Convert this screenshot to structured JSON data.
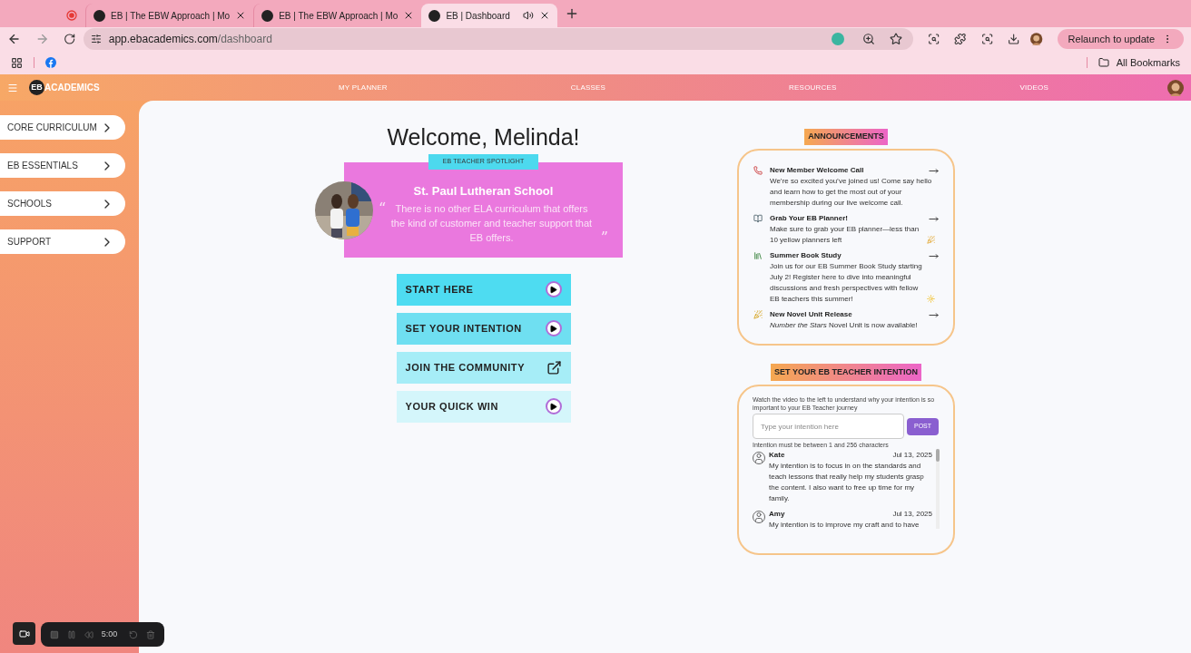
{
  "browser": {
    "tabs": [
      {
        "kind": "recording",
        "selected": false
      },
      {
        "kind": "page",
        "title": "EB | The EBW Approach | Mo",
        "selected": false,
        "audio": false
      },
      {
        "kind": "page",
        "title": "EB | The EBW Approach | Mo",
        "selected": false,
        "audio": false
      },
      {
        "kind": "page",
        "title": "EB | Dashboard",
        "selected": true,
        "audio": true
      }
    ],
    "url_host": "app.ebacademics.com",
    "url_path": "/dashboard",
    "relaunch": "Relaunch to update",
    "bookmarks_folder": "All Bookmarks"
  },
  "site_nav": {
    "logo_mark": "EB",
    "logo_text": "ACADEMICS",
    "links": [
      "MY PLANNER",
      "CLASSES",
      "RESOURCES",
      "VIDEOS"
    ]
  },
  "sidebar": {
    "items": [
      "CORE CURRICULUM",
      "EB ESSENTIALS",
      "SCHOOLS",
      "SUPPORT"
    ]
  },
  "welcome": "Welcome, Melinda!",
  "spotlight": {
    "label": "EB TEACHER SPOTLIGHT",
    "school": "St. Paul Lutheran School",
    "open_quote": "“",
    "close_quote": "”",
    "quote": "There is no other ELA curriculum that offers the kind of customer and teacher support that EB offers."
  },
  "actions": [
    {
      "label": "START HERE",
      "kind": "video"
    },
    {
      "label": "SET YOUR INTENTION",
      "kind": "video"
    },
    {
      "label": "JOIN THE COMMUNITY",
      "kind": "external"
    },
    {
      "label": "YOUR QUICK WIN",
      "kind": "video"
    }
  ],
  "announcements": {
    "title": "ANNOUNCEMENTS",
    "items": [
      {
        "kind": "phone",
        "title": "New Member Welcome Call",
        "body": "We’re so excited you’ve joined us! Come say hello and learn how to get the most out of your membership during our live welcome call."
      },
      {
        "kind": "planner",
        "title": "Grab Your EB Planner!",
        "body": "Make sure to grab your EB planner—less than 10 yellow planners left"
      },
      {
        "kind": "books",
        "title": "Summer Book Study",
        "body": "Join us for our EB Summer Book Study starting July 2! Register here to dive into meaningful discussions and fresh perspectives with fellow EB teachers this summer!"
      },
      {
        "kind": "party",
        "title": "New Novel Unit Release",
        "body": "*Number the Stars* Novel Unit is now available!"
      }
    ]
  },
  "intention": {
    "title": "SET YOUR EB TEACHER INTENTION",
    "hint": "Watch the video to the left to understand why your intention is so important to your EB Teacher journey",
    "placeholder": "Type your intention here",
    "post": "POST",
    "rule": "Intention must be between 1 and 256 characters",
    "entries": [
      {
        "name": "Kate",
        "date": "Jul 13, 2025",
        "text": "My intention is to focus in on the standards and teach lessons that really help my students grasp the content. I also want to free up time for my family."
      },
      {
        "name": "Amy",
        "date": "Jul 13, 2025",
        "text": "My intention is to improve my craft and to have"
      }
    ]
  },
  "recorder": {
    "time": "5:00"
  }
}
